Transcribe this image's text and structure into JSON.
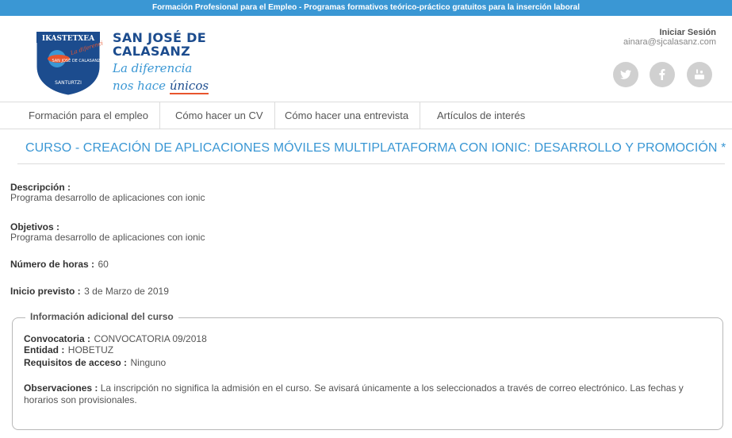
{
  "topbar": {
    "text": "Formación Profesional para el Empleo - Programas formativos teórico-práctico gratuitos para la inserción laboral"
  },
  "logo": {
    "badge_text": "IKASTETXEA",
    "badge_sub": "SAN JOSÉ DE CALASANZ",
    "badge_city": "SANTURTZI",
    "badge_slogan": "La diferencia"
  },
  "brand": {
    "line1": "SAN JOSÉ DE",
    "line2": "CALASANZ",
    "tagline1": "La diferencia",
    "tagline2_prefix": "nos hace ",
    "tagline2_emph": "únicos"
  },
  "login": {
    "label": "Iniciar Sesión",
    "email": "ainara@sjcalasanz.com"
  },
  "social": [
    "twitter-icon",
    "facebook-icon",
    "youtube-icon"
  ],
  "nav": {
    "items": [
      "Formación para el empleo",
      "Cómo hacer un CV",
      "Cómo hacer una entrevista",
      "Artículos de interés"
    ]
  },
  "course": {
    "title": "CURSO - CREACIÓN DE APLICACIONES MÓVILES MULTIPLATAFORMA CON IONIC: DESARROLLO Y PROMOCIÓN *",
    "descripcion_label": "Descripción :",
    "descripcion": "Programa desarrollo de aplicaciones con ionic",
    "objetivos_label": "Objetivos :",
    "objetivos": "Programa desarrollo de aplicaciones con ionic",
    "horas_label": "Número de horas :",
    "horas": "60",
    "inicio_label": "Inicio previsto :",
    "inicio": "3 de Marzo de 2019"
  },
  "extra": {
    "legend": "Información adicional del curso",
    "convocatoria_label": "Convocatoria :",
    "convocatoria": "CONVOCATORIA 09/2018",
    "entidad_label": "Entidad :",
    "entidad": "HOBETUZ",
    "requisitos_label": "Requisitos de acceso :",
    "requisitos": "Ninguno",
    "observaciones_label": "Observaciones :",
    "observaciones": "La inscripción no significa la admisión en el curso. Se avisará únicamente a los seleccionados a través de correo electrónico. Las fechas y horarios son provisionales."
  },
  "colors": {
    "accent": "#3a97d4",
    "brand_dark": "#1c4c8e",
    "brand_orange": "#e8552d",
    "social_bg": "#d0d0d0"
  }
}
